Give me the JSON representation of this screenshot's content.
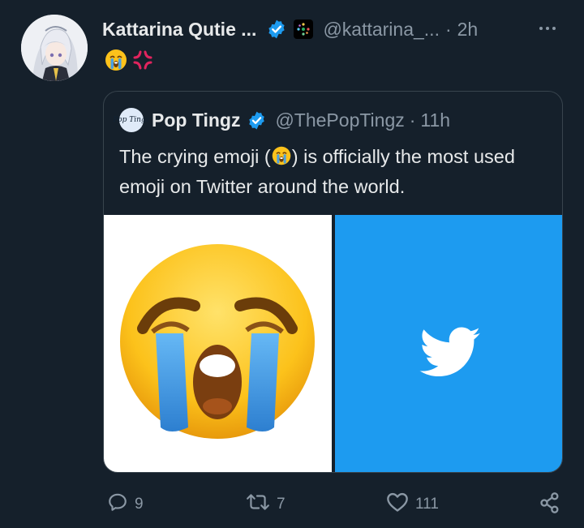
{
  "tweet": {
    "display_name": "Kattarina Qutie ...",
    "handle": "@kattarina_...",
    "separator": "·",
    "time": "2h",
    "reaction_emojis": [
      "loudly-crying-face",
      "anger-symbol"
    ]
  },
  "quote": {
    "name": "Pop Tingz",
    "avatar_text": "Pop Tingz",
    "handle": "@ThePopTingz",
    "separator": "·",
    "time": "11h",
    "text_before": "The crying emoji (",
    "text_after": ") is officially the most used emoji on Twitter around the world.",
    "media": [
      "loudly-crying-face-emoji-image",
      "twitter-bird-logo-image"
    ]
  },
  "actions": {
    "replies": "9",
    "retweets": "7",
    "likes": "111"
  },
  "colors": {
    "background": "#15202b",
    "text_primary": "#e7e9ea",
    "text_secondary": "#8b98a5",
    "verified_blue": "#1d9bf0",
    "border": "#38444d"
  }
}
